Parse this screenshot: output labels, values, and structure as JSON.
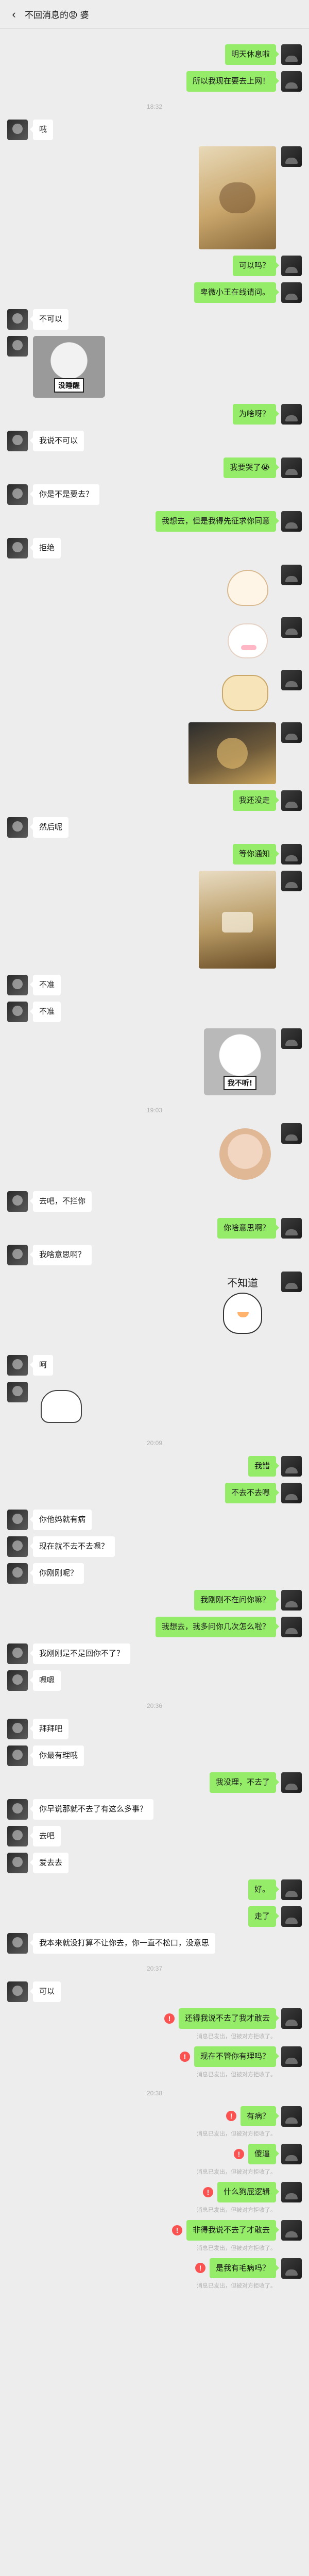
{
  "header": {
    "back_icon": "chevron-left-icon",
    "title": "不回消息的😡 婆"
  },
  "colors": {
    "me_bubble": "#95ec69",
    "them_bubble": "#ffffff",
    "background": "#ededed",
    "fail": "#fa5151"
  },
  "times": [
    "18:32",
    "19:03",
    "20:09",
    "20:36",
    "20:37",
    "20:38"
  ],
  "stickers": {
    "sleepy": "没睡醒",
    "tsk": "我不听!",
    "dunno": "不知道"
  },
  "messages": {
    "m1": "明天休息啦",
    "m2": "所以我现在要去上网！",
    "m3": "哦",
    "m4": "可以吗？",
    "m5": "卑微小王在线请问。",
    "m6": "不可以",
    "m7": "为啥呀？",
    "m8": "我说不可以",
    "m9": "我要哭了😭",
    "m10": "你是不是要去？",
    "m11": "我想去，但是我得先征求你同意",
    "m12": "拒绝",
    "m13": "我还没走",
    "m14": "然后呢",
    "m15": "等你通知",
    "m16": "不准",
    "m17": "不准",
    "m18": "去吧，不拦你",
    "m19": "你啥意思啊？",
    "m20": "我啥意思啊？",
    "m21": "呵",
    "m22": "我错",
    "m23": "不去不去嗯",
    "m24": "你他妈就有病",
    "m25": "现在就不去不去嗯？",
    "m26": "你刚刚呢？",
    "m27": "我刚刚不在问你嘛？",
    "m28": "我想去，我多问你几次怎么啦？",
    "m29": "我刚刚是不是回你不了？",
    "m30": "嗯嗯",
    "m31": "拜拜吧",
    "m32": "你最有理哦",
    "m33": "我没理，不去了",
    "m34": "你早说那就不去了有这么多事？",
    "m35": "去吧",
    "m36": "爱去去",
    "m37": "好。",
    "m38": "走了",
    "m39": "我本来就没打算不让你去，你一直不松口，没意思",
    "m40": "可以",
    "m41": "还得我说不去了我才敢去",
    "m42": "现在不管你有理吗？",
    "m43": "有病？",
    "m44": "傻逼",
    "m45": "什么狗屁逻辑",
    "m46": "非得我说不去了才敢去",
    "m47": "是我有毛病吗？"
  },
  "blocked_notice": "消息已发出，但被对方拒收了。"
}
